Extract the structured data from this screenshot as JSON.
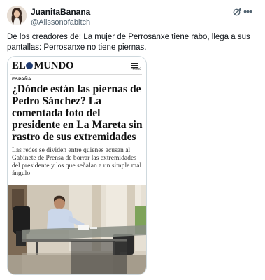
{
  "author": {
    "display_name": "JuanitaBanana",
    "handle": "@Alissonofabitch"
  },
  "icons": {
    "grok": "grok-icon",
    "more": "more-icon"
  },
  "tweet": {
    "text": "De los creadores de: La mujer de Perrosanxe tiene rabo, llega a sus pantallas: Perrosanxe no tiene piernas."
  },
  "article": {
    "logo_left": "EL",
    "logo_right": "MUNDO",
    "menu_label": "Menú",
    "section": "ESPAÑA",
    "headline": "¿Dónde están las piernas de Pedro Sánchez? La comentada foto del presidente en La Mareta sin rastro de sus extremidades",
    "subhead": "Las redes se dividen entre quienes acusan al Gabinete de Prensa de borrar las extremidades del presidente y los que señalan a un simple mal ángulo"
  },
  "colors": {
    "text_primary": "#0f1419",
    "text_secondary": "#536471",
    "card_border": "#cfd9de",
    "logo_globe": "#1f3b70"
  }
}
